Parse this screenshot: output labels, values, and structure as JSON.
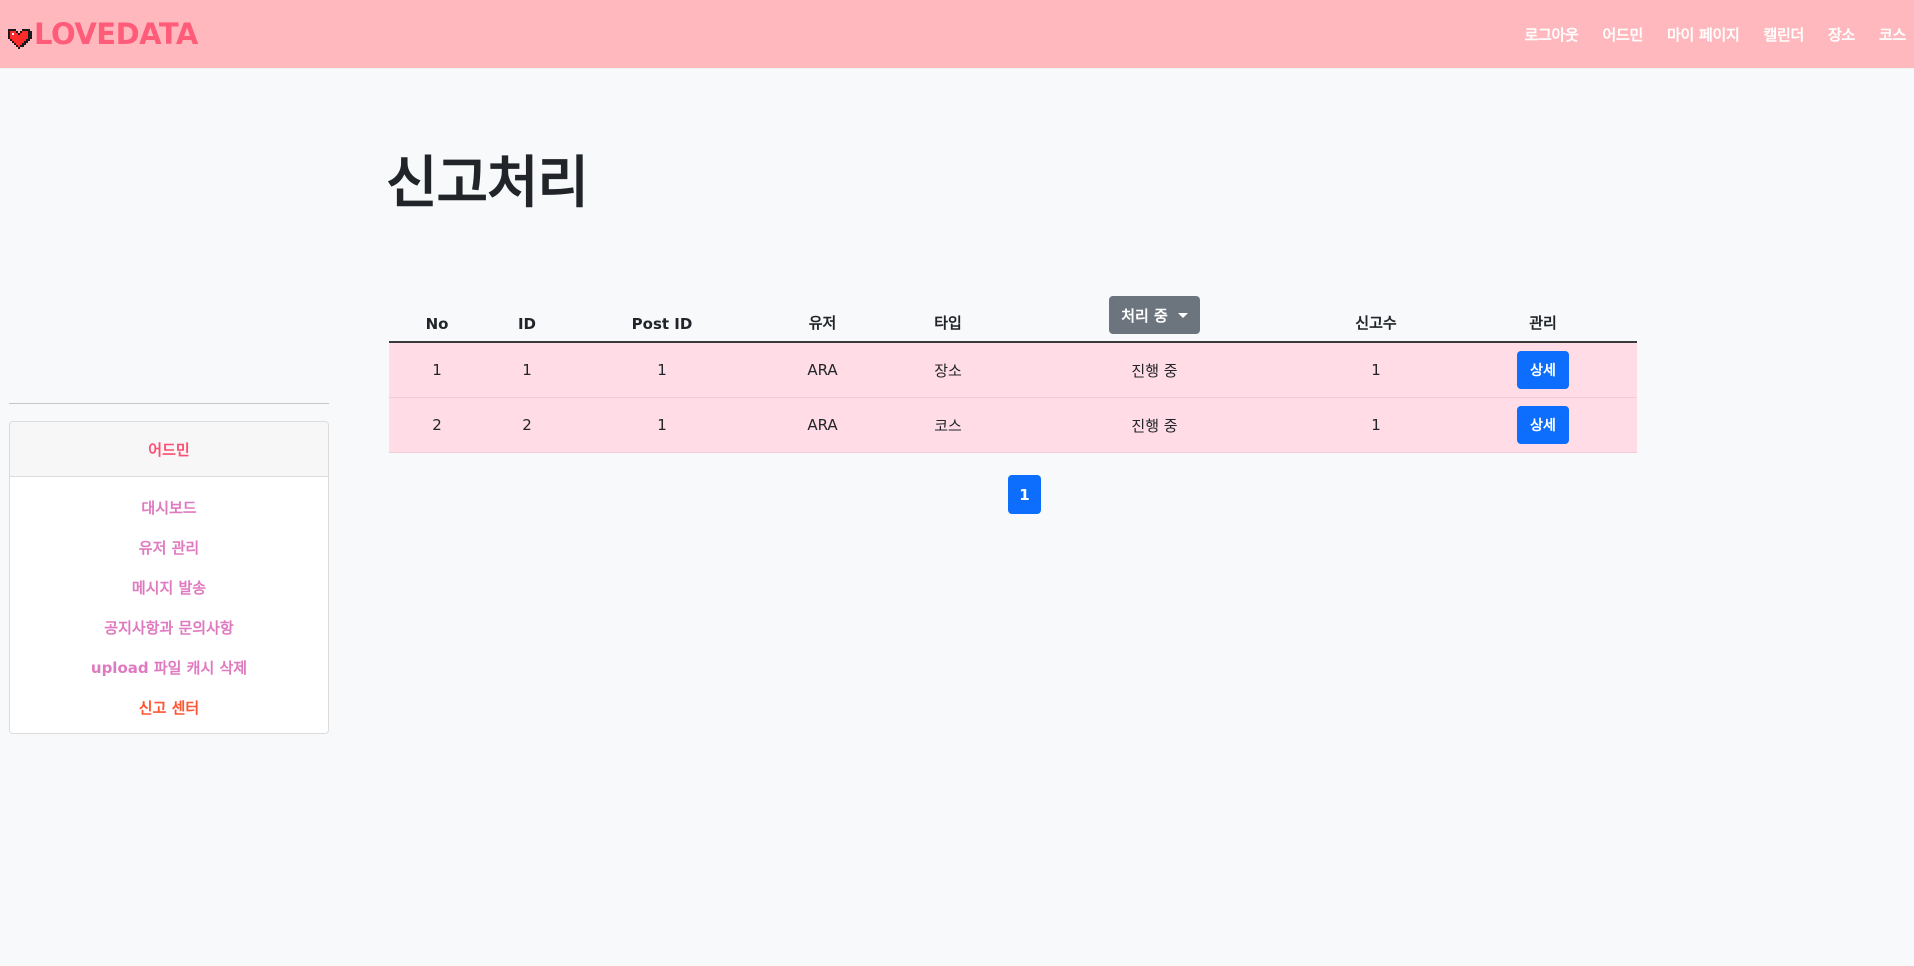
{
  "brand": {
    "name": "LOVEDATA",
    "icon": "heart-icon"
  },
  "nav": {
    "links": [
      "로그아웃",
      "어드민",
      "마이 페이지",
      "캘린더",
      "장소",
      "코스"
    ]
  },
  "sidebar": {
    "header": "어드민",
    "items": [
      {
        "label": "대시보드"
      },
      {
        "label": "유저 관리"
      },
      {
        "label": "메시지 발송"
      },
      {
        "label": "공지사항과 문의사항"
      },
      {
        "label": "upload 파일 캐시 삭제"
      },
      {
        "label": "신고 센터"
      }
    ],
    "active_index": 5
  },
  "main": {
    "title": "신고처리",
    "table": {
      "headers": [
        "No",
        "ID",
        "Post ID",
        "유저",
        "타입",
        "처리 중",
        "신고수",
        "관리"
      ],
      "status_filter_label": "처리 중",
      "rows": [
        {
          "no": "1",
          "id": "1",
          "post_id": "1",
          "user": "ARA",
          "type": "장소",
          "status": "진행 중",
          "count": "1",
          "action": "상세"
        },
        {
          "no": "2",
          "id": "2",
          "post_id": "1",
          "user": "ARA",
          "type": "코스",
          "status": "진행 중",
          "count": "1",
          "action": "상세"
        }
      ]
    },
    "pagination": {
      "pages": [
        "1"
      ],
      "current": "1"
    }
  },
  "colors": {
    "navbar_bg": "#ffb9be",
    "brand": "#ff5c7a",
    "row_bg": "#ffdce6",
    "primary": "#0d6efd",
    "secondary": "#6c757d",
    "sidebar_link": "#e07ac0",
    "sidebar_active": "#ff5533"
  }
}
